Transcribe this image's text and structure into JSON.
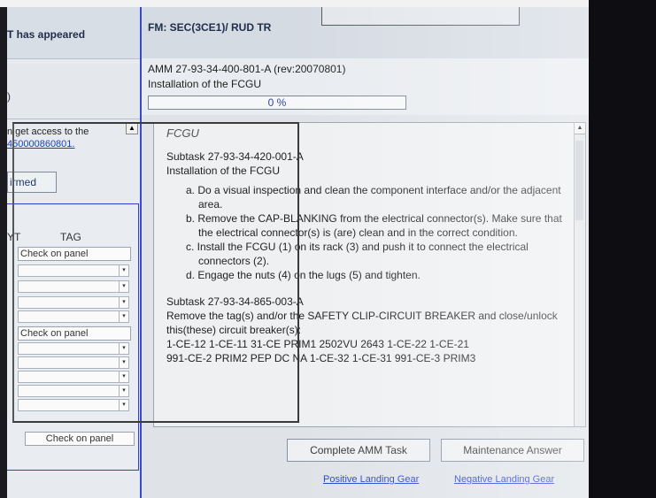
{
  "left": {
    "header_text": "T has appeared",
    "sub_text": ")",
    "info_line1": "n get access to the",
    "info_link": "450000860801.",
    "info_link_prefix": "",
    "confirmed_label": "irmed",
    "tag_table": {
      "col1": "YT",
      "col2": "TAG",
      "rows": [
        "Check on panel",
        "Check on panel"
      ],
      "bottom_cell": "Check on panel"
    }
  },
  "header": {
    "fm_text": "FM: SEC(3CE1)/ RUD TR"
  },
  "amm": {
    "reference": "AMM 27-93-34-400-801-A (rev:20070801)",
    "title": "Installation of the FCGU",
    "progress_text": "0 %",
    "progress_value": 0
  },
  "content": {
    "heading": "FCGU",
    "subtask1": "Subtask 27-93-34-420-001-A",
    "subtask1_title": "Installation of the FCGU",
    "steps": [
      "a. Do a visual inspection and clean the component interface and/or the adjacent area.",
      "b. Remove the CAP-BLANKING from the electrical connector(s). Make sure that the electrical connector(s) is (are) clean and in the correct condition.",
      "c. Install the FCGU (1) on its rack (3) and push it to connect the electrical connectors (2).",
      "d. Engage the nuts (4) on the lugs (5) and tighten."
    ],
    "subtask2": "Subtask 27-93-34-865-003-A",
    "subtask2_text": "Remove the tag(s) and/or the SAFETY CLIP-CIRCUIT BREAKER and close/unlock this(these) circuit breaker(s):",
    "breakers_line1": "1-CE-12 1-CE-11 31-CE PRIM1 2502VU 2643 1-CE-22 1-CE-21",
    "breakers_line2": "991-CE-2 PRIM2 PEP DC NA 1-CE-32 1-CE-31 991-CE-3 PRIM3"
  },
  "buttons": {
    "complete": "Complete AMM Task",
    "maintenance": "Maintenance Answer"
  },
  "links": {
    "positive": "Positive Landing Gear",
    "negative": "Negative Landing Gear"
  },
  "colors": {
    "link": "#2741d0",
    "divider": "#3a49c9",
    "background": "#dfe3e8"
  }
}
